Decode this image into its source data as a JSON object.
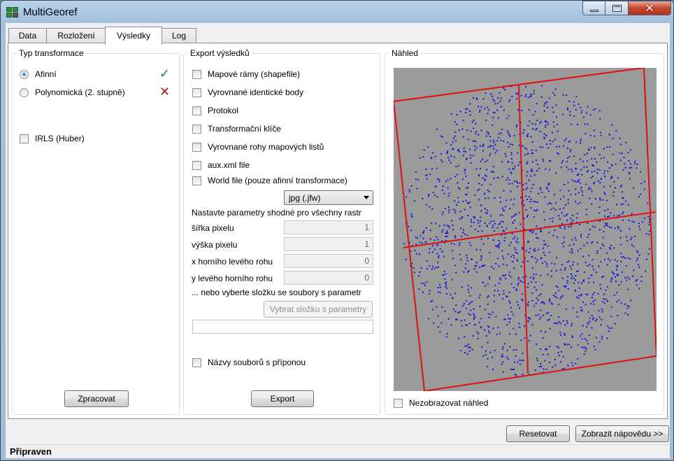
{
  "window": {
    "title": "MultiGeoref"
  },
  "tabs": [
    {
      "label": "Data"
    },
    {
      "label": "Rozložení"
    },
    {
      "label": "Výsledky"
    },
    {
      "label": "Log"
    }
  ],
  "transform_group": {
    "title": "Typ transformace",
    "options": [
      {
        "label": "Afinní",
        "checked": true,
        "status_icon": "check-icon"
      },
      {
        "label": "Polynomická (2. stupně)",
        "checked": false,
        "status_icon": "cross-icon"
      }
    ],
    "irls_label": "IRLS (Huber)",
    "process_button": "Zpracovat"
  },
  "export_group": {
    "title": "Export výsledků",
    "checkboxes": [
      {
        "label": "Mapové rámy (shapefile)"
      },
      {
        "label": "Vyrovnané identické body"
      },
      {
        "label": "Protokol"
      },
      {
        "label": "Transformační klíče"
      },
      {
        "label": "Vyrovnané rohy mapových listů"
      },
      {
        "label": "aux.xml file"
      },
      {
        "label": "World file (pouze afinní transformace)"
      }
    ],
    "world_file_ext": "jpg (.jfw)",
    "params_note": "Nastavte parametry shodné pro všechny rastr",
    "params": [
      {
        "label": "šířka pixelu",
        "value": "1"
      },
      {
        "label": "výška pixelu",
        "value": "1"
      },
      {
        "label": "x horního levého rohu",
        "value": "0"
      },
      {
        "label": "y levého horního rohu",
        "value": "0"
      }
    ],
    "folder_note": "... nebo vyberte složku se soubory s parametr",
    "folder_button": "Vybrat složku s parametry",
    "folder_path": "",
    "filenames_label": "Názvy souborů s příponou",
    "export_button": "Export"
  },
  "preview_group": {
    "title": "Náhled",
    "hide_label": "Nezobrazovat náhled",
    "colors": {
      "frame": "#e01010",
      "points": "#1515d8",
      "background": "#9b9b9b"
    }
  },
  "footer": {
    "reset_button": "Resetovat",
    "help_button": "Zobrazit nápovědu >>"
  },
  "status": {
    "text": "Připraven"
  }
}
